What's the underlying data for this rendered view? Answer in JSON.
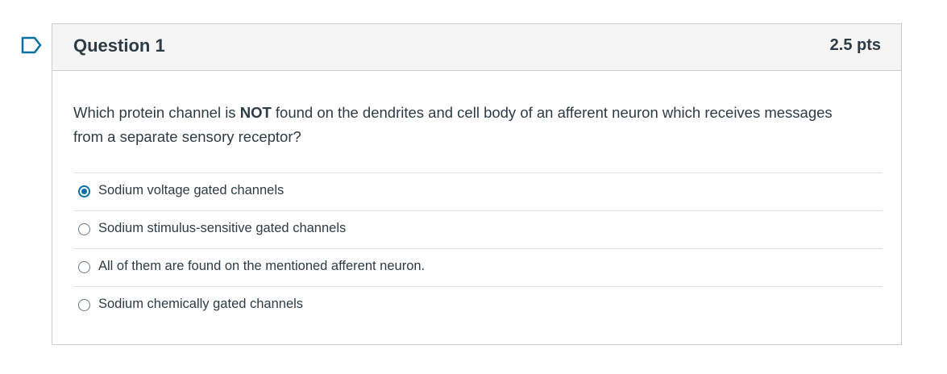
{
  "question": {
    "title": "Question 1",
    "points": "2.5 pts",
    "text_before": "Which protein channel is ",
    "text_emphasis": "NOT",
    "text_after": " found on the dendrites and cell body of an afferent neuron which receives messages from a separate sensory receptor?"
  },
  "answers": [
    {
      "label": "Sodium voltage gated channels",
      "selected": true
    },
    {
      "label": "Sodium stimulus-sensitive gated channels",
      "selected": false
    },
    {
      "label": "All of them are found on the mentioned afferent neuron.",
      "selected": false
    },
    {
      "label": "Sodium chemically gated channels",
      "selected": false
    }
  ],
  "colors": {
    "accent": "#0770a3",
    "text": "#2d3b45",
    "header_bg": "#f5f5f5",
    "border": "#c7cdd1"
  },
  "icons": {
    "flag": "flag-question-icon"
  }
}
